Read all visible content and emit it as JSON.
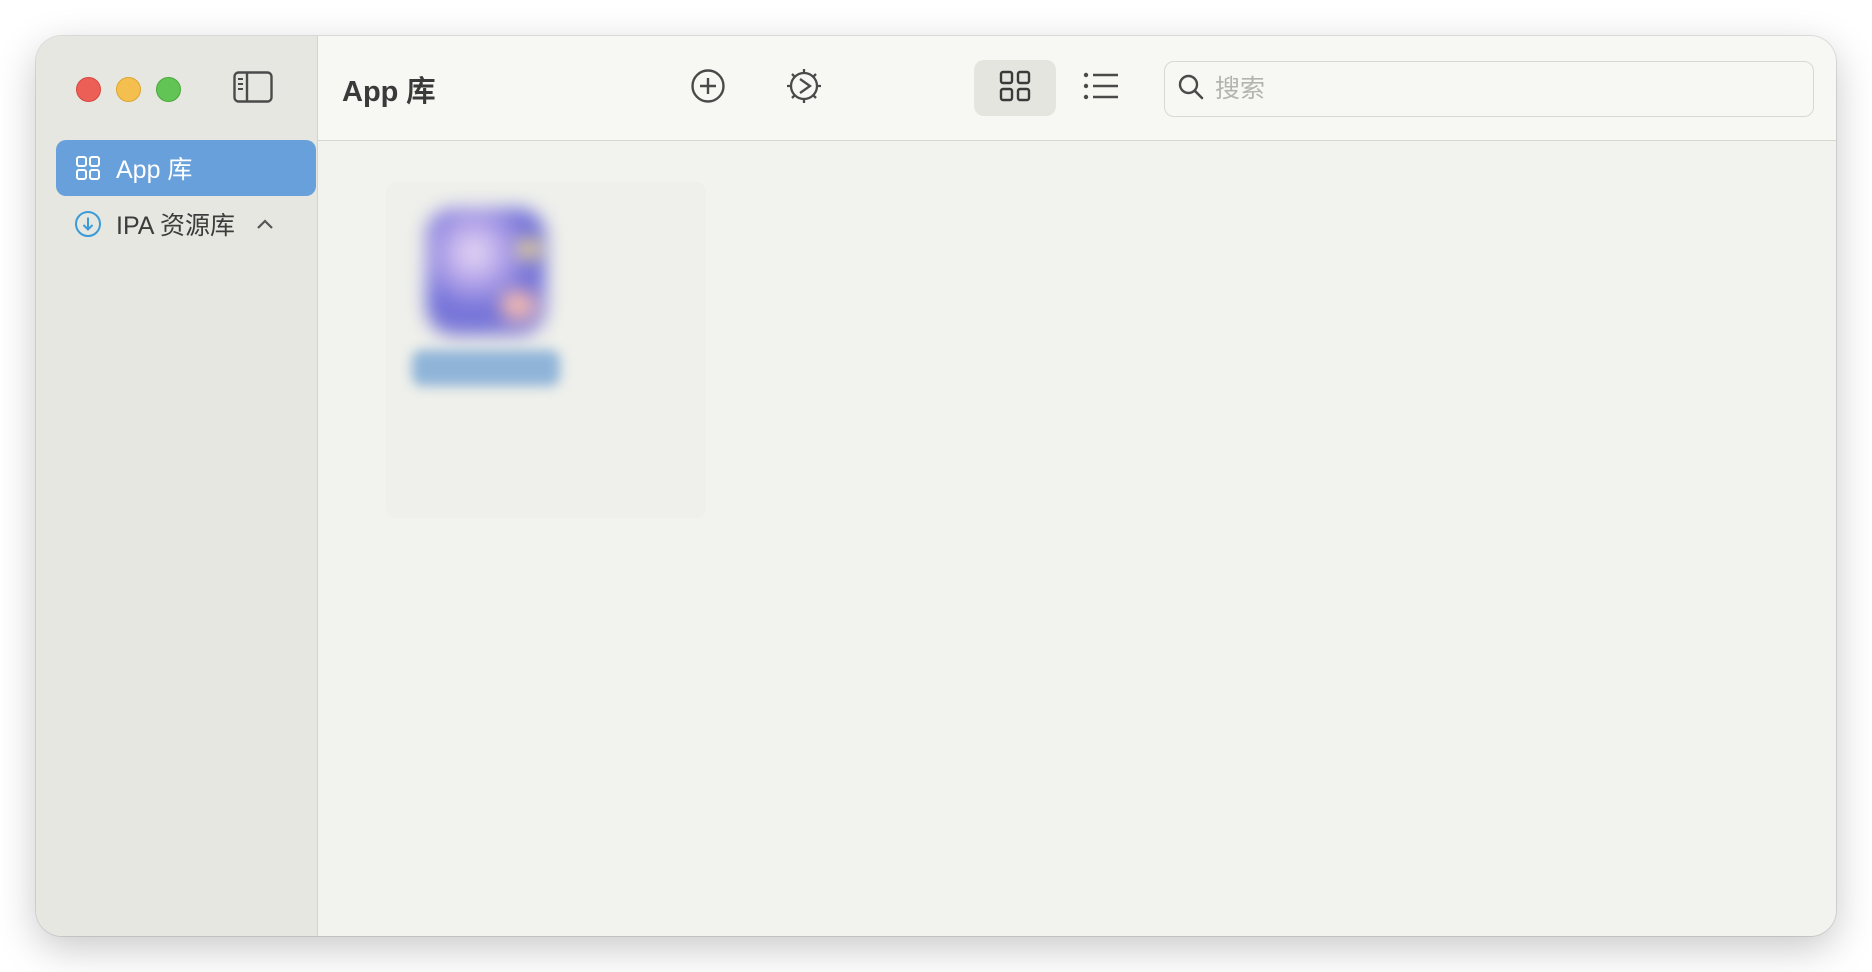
{
  "window": {
    "controls": [
      "close",
      "minimize",
      "maximize"
    ]
  },
  "sidebar": {
    "toggle_icon": "sidebar-left-icon",
    "items": [
      {
        "label": "App 库",
        "icon": "grid-icon",
        "active": true
      },
      {
        "label": "IPA 资源库",
        "icon": "arrow-down-circle-icon",
        "expandable": true,
        "chevron": "chevron-up-icon"
      }
    ]
  },
  "toolbar": {
    "title": "App 库",
    "buttons": [
      {
        "name": "add",
        "icon": "plus-circle-icon"
      },
      {
        "name": "settings",
        "icon": "gear-play-icon"
      },
      {
        "name": "grid-view",
        "icon": "grid-icon",
        "selected": true
      },
      {
        "name": "list-view",
        "icon": "list-icon"
      }
    ],
    "search": {
      "placeholder": "搜索",
      "value": "",
      "icon": "search-icon"
    }
  },
  "colors": {
    "accent": "#67a0da",
    "sidebar_bg": "#e6e7e1",
    "content_bg": "#f2f3ee",
    "download_icon": "#3a9bd9"
  }
}
